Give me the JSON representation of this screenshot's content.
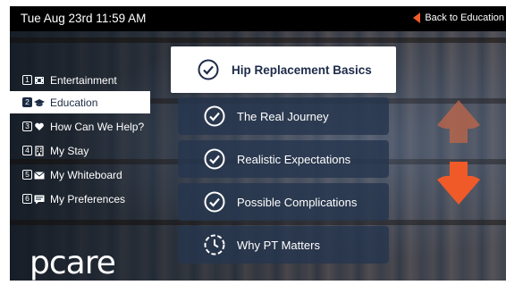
{
  "status_bar": {
    "datetime": "Tue Aug 23rd 11:59 AM",
    "back_label": "Back to Education"
  },
  "sidebar": {
    "items": [
      {
        "number": "1",
        "label": "Entertainment",
        "icon": "film-icon",
        "active": false
      },
      {
        "number": "2",
        "label": "Education",
        "icon": "graduation-cap-icon",
        "active": true
      },
      {
        "number": "3",
        "label": "How Can We Help?",
        "icon": "heart-hand-icon",
        "active": false
      },
      {
        "number": "4",
        "label": "My Stay",
        "icon": "building-icon",
        "active": false
      },
      {
        "number": "5",
        "label": "My Whiteboard",
        "icon": "envelope-icon",
        "active": false
      },
      {
        "number": "6",
        "label": "My Preferences",
        "icon": "chat-icon",
        "active": false
      }
    ],
    "logo_text": "pcare"
  },
  "menu": {
    "title_item": {
      "label": "Hip Replacement Basics",
      "icon": "check-circle-icon"
    },
    "items": [
      {
        "label": "The Real Journey",
        "icon": "check-circle-icon"
      },
      {
        "label": "Realistic Expectations",
        "icon": "check-circle-icon"
      },
      {
        "label": "Possible Complications",
        "icon": "check-circle-icon"
      },
      {
        "label": "Why PT Matters",
        "icon": "clock-dashed-icon"
      }
    ]
  },
  "scroll": {
    "up_icon": "arrow-up-icon",
    "down_icon": "arrow-down-icon"
  },
  "colors": {
    "accent": "#f05a28",
    "accent_dim": "#b9654a",
    "nav_active_text": "#1b2a44"
  }
}
